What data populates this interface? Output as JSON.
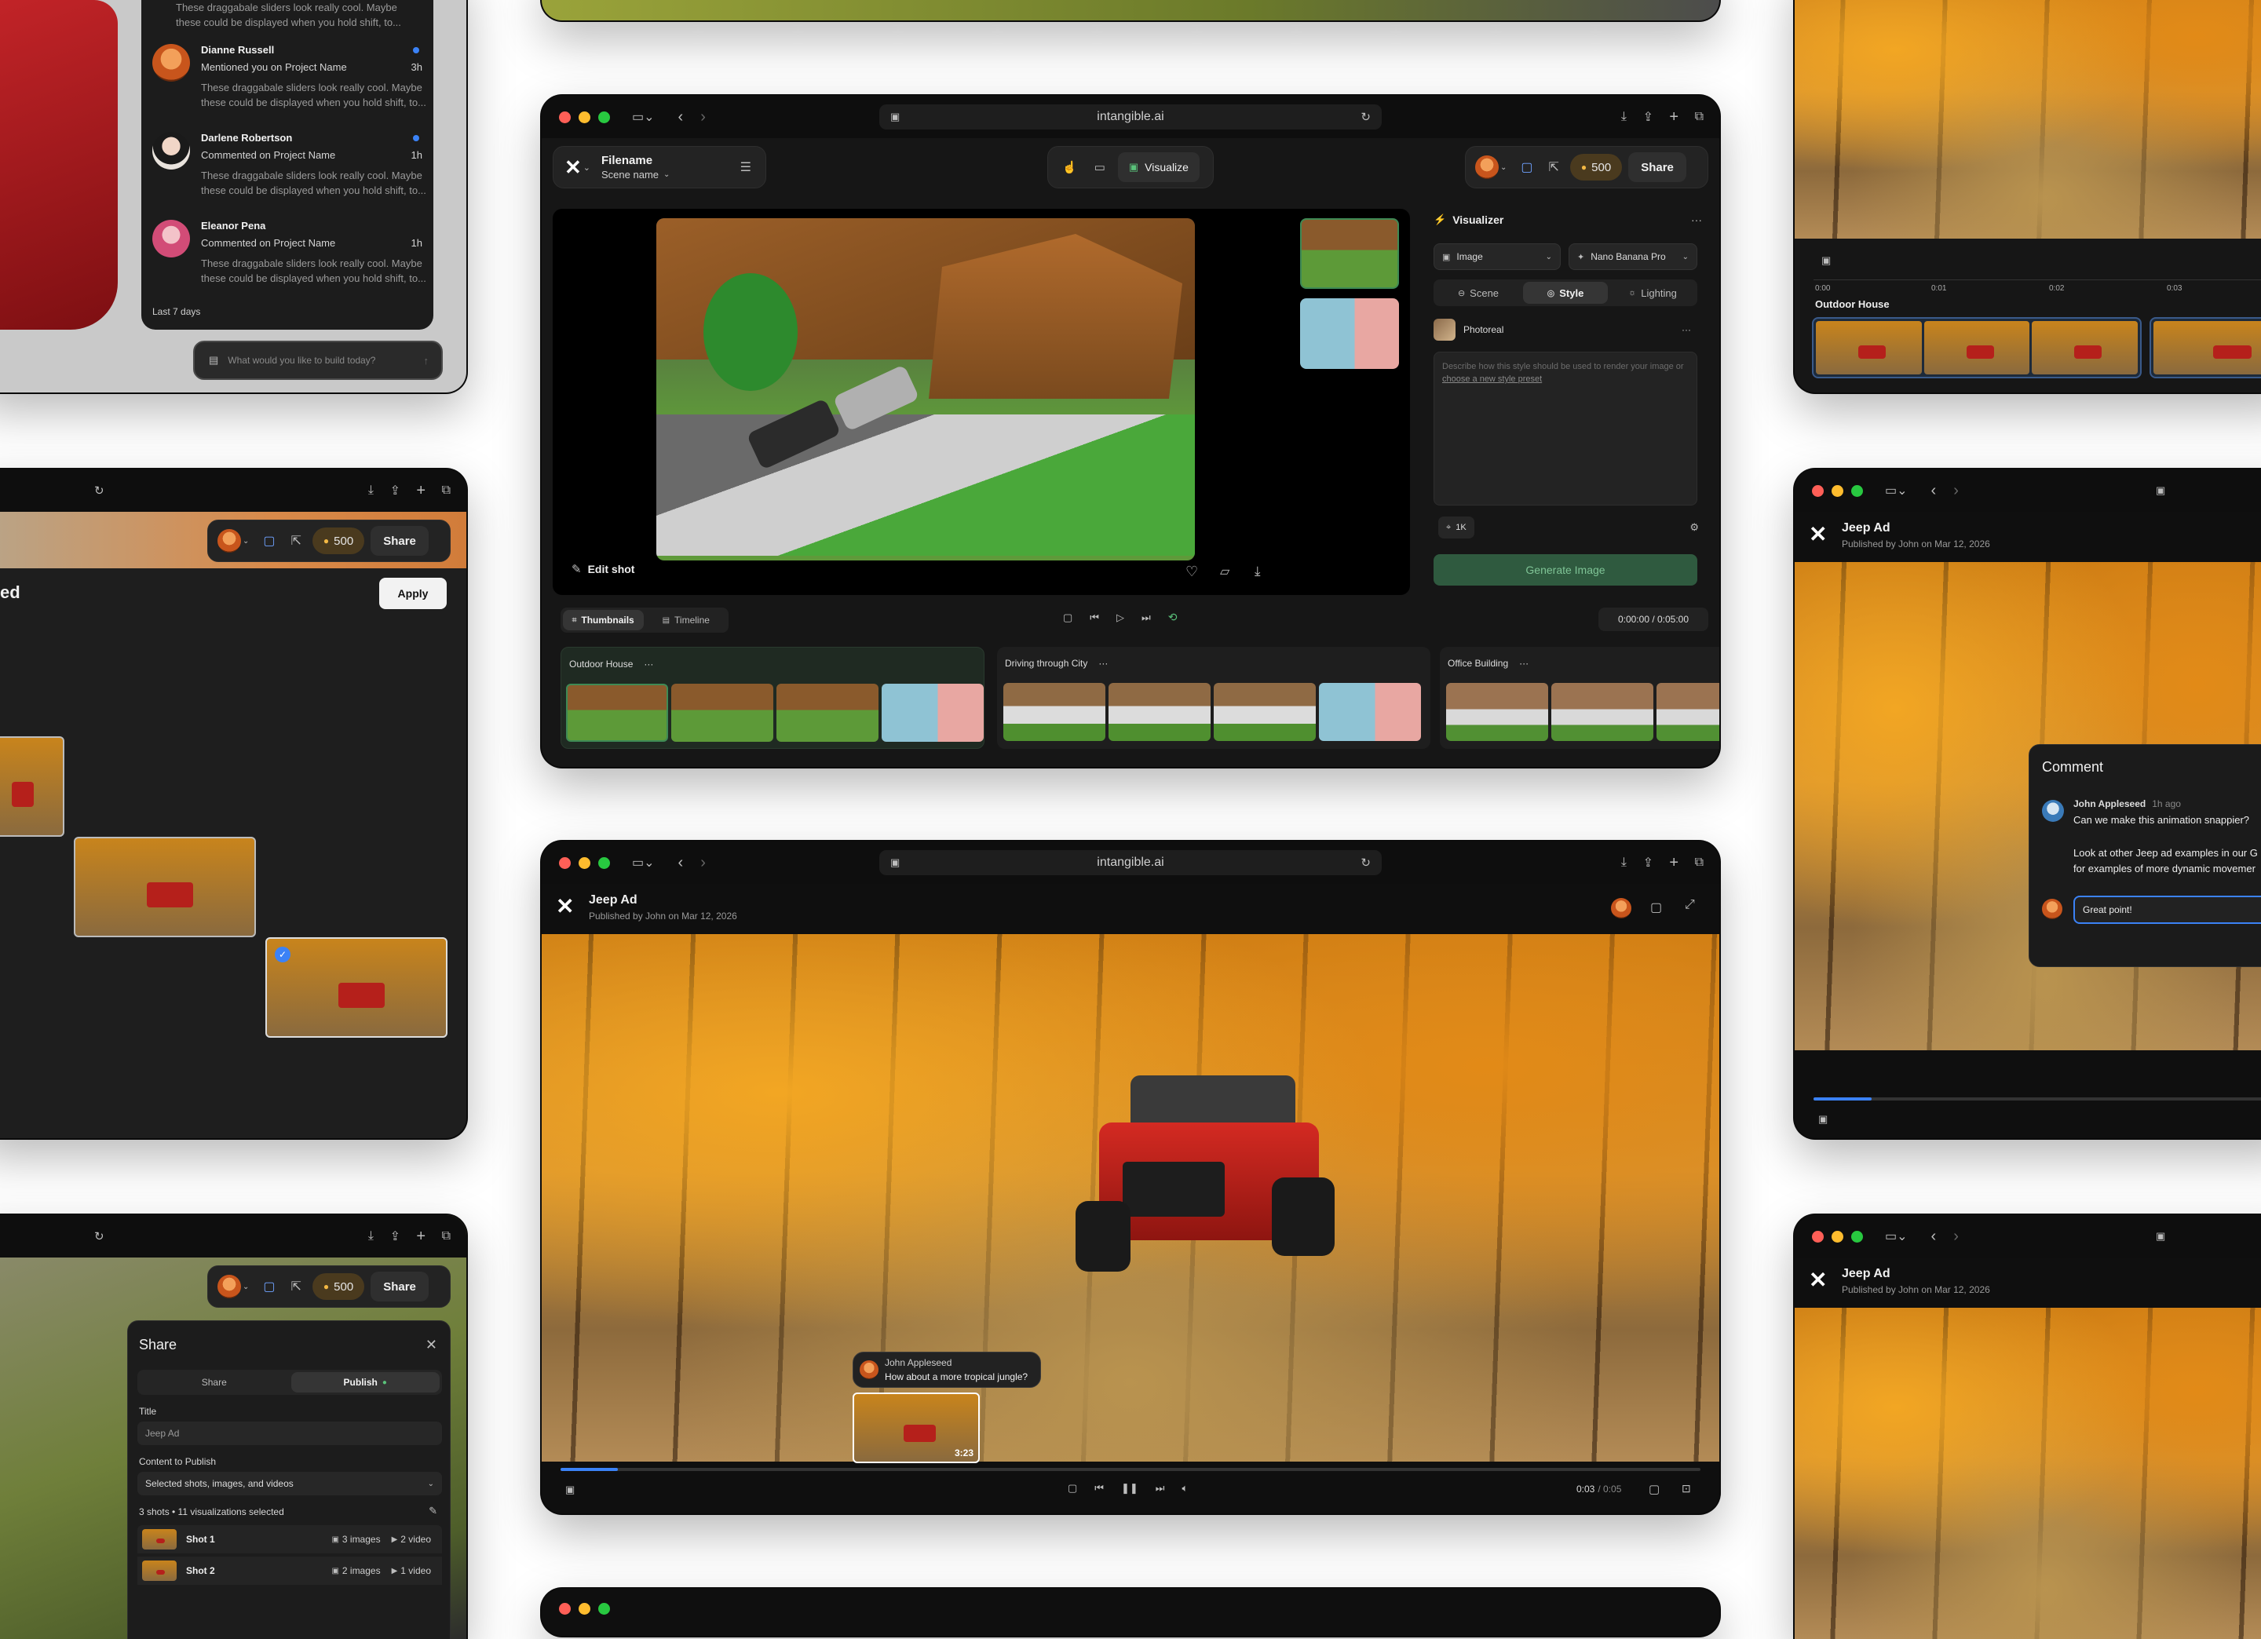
{
  "browser": {
    "url": "intangible.ai"
  },
  "editor": {
    "filename": "Filename",
    "scene_name": "Scene name",
    "mode_label": "Visualize",
    "credits": "500",
    "share_label": "Share",
    "edit_shot_label": "Edit shot",
    "visualizer": {
      "title": "Visualizer",
      "output_type": "Image",
      "model": "Nano Banana Pro",
      "tabs": [
        "Scene",
        "Style",
        "Lighting"
      ],
      "active_tab": "Style",
      "preset_name": "Photoreal",
      "prompt_placeholder": "Describe how this style should be used to render your image or",
      "prompt_link": "choose a new style preset",
      "resolution": "1K",
      "generate_label": "Generate Image"
    },
    "view_tabs": [
      "Thumbnails",
      "Timeline"
    ],
    "time": "0:00:00 / 0:05:00",
    "scenes": [
      {
        "name": "Outdoor House",
        "more": "···"
      },
      {
        "name": "Driving through City",
        "more": "···"
      },
      {
        "name": "Office Building",
        "more": "···"
      }
    ]
  },
  "player": {
    "title": "Jeep Ad",
    "meta": "Published by John on Mar 12, 2026",
    "comment_author": "John Appleseed",
    "comment_text": "How about a more tropical jungle?",
    "thumb_time": "3:23",
    "time_current": "0:03",
    "time_total": "/ 0:05"
  },
  "notifications": {
    "items": [
      {
        "name": "",
        "action": "",
        "body": "These draggabale sliders look really cool. Maybe these could be displayed when you hold shift, to..."
      },
      {
        "name": "Dianne Russell",
        "action": "Mentioned you on Project Name",
        "time": "3h",
        "body": "These draggabale sliders look really cool. Maybe these could be displayed when you hold shift, to..."
      },
      {
        "name": "Darlene Robertson",
        "action": "Commented on Project Name",
        "time": "1h",
        "body": "These draggabale sliders look really cool. Maybe these could be displayed when you hold shift, to..."
      },
      {
        "name": "Eleanor Pena",
        "action": "Commented on Project Name",
        "time": "1h",
        "body": "These draggabale sliders look really cool. Maybe these could be displayed when you hold shift, to..."
      }
    ],
    "section": "Last 7 days",
    "input_placeholder": "What would you like to build today?"
  },
  "gallery": {
    "heading_fragment": "ed",
    "apply_label": "Apply",
    "credits": "500",
    "share_label": "Share"
  },
  "share_panel": {
    "title": "Share",
    "tabs": [
      "Share",
      "Publish"
    ],
    "title_label": "Title",
    "title_value": "Jeep Ad",
    "content_label": "Content to Publish",
    "content_value": "Selected shots, images, and videos",
    "summary": "3 shots • 11 visualizations selected",
    "shots": [
      {
        "name": "Shot 1",
        "images": "3 images",
        "videos": "2 video"
      },
      {
        "name": "Shot 2",
        "images": "2 images",
        "videos": "1 video"
      }
    ],
    "credits": "500",
    "share_label": "Share"
  },
  "right_top": {
    "scene": "Outdoor House",
    "ticks": [
      "0:00",
      "0:01",
      "0:02",
      "0:03"
    ]
  },
  "right_mid": {
    "title": "Jeep Ad",
    "meta": "Published by John on Mar 12, 2026",
    "comment_panel_title": "Comment",
    "comment_author": "John Appleseed",
    "comment_time": "1h ago",
    "comment_text": "Can we make this animation snappier?",
    "reply_text": "Look at other Jeep ad examples in our G",
    "reply_text2": "for examples of more dynamic movemer",
    "input_value": "Great point!"
  },
  "right_bottom": {
    "title": "Jeep Ad",
    "meta": "Published by John on Mar 12, 2026"
  },
  "colors": {
    "accent_green": "#2f7a4a",
    "mac_red": "#ff5f57",
    "mac_yellow": "#febc2e",
    "mac_green": "#28c840",
    "progress_blue": "#3b82f6"
  }
}
